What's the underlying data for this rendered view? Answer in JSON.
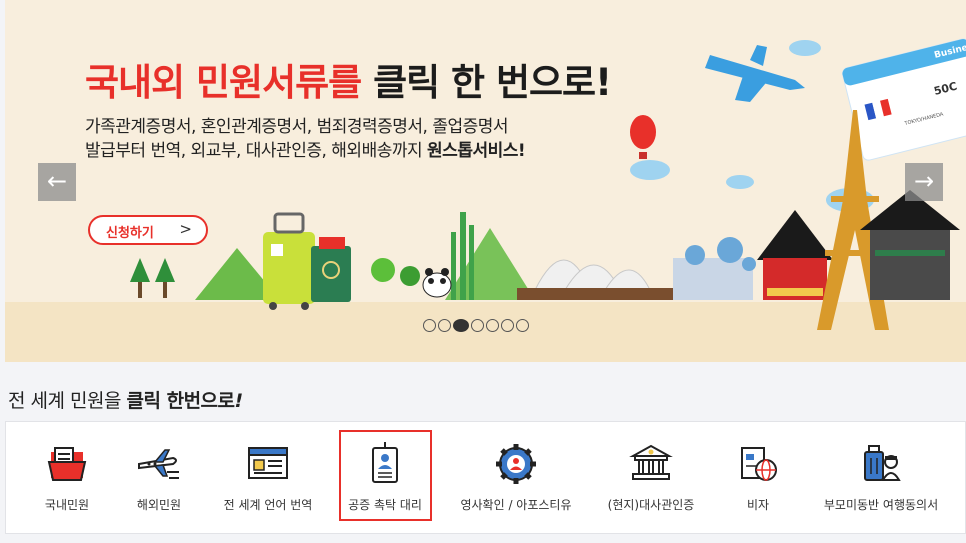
{
  "banner": {
    "headline_red": "국내외 민원서류를",
    "headline_dark": "클릭 한 번으로!",
    "line1": "가족관계증명서, 혼인관계증명서, 범죄경력증명서, 졸업증명서",
    "line2_prefix": "발급부터 번역, 외교부, 대사관인증, 해외배송까지",
    "line2_bold": "원스톱서비스!",
    "apply_label": "신청하기",
    "apply_arrow": ">",
    "prev_arrow": "←",
    "next_arrow": "→",
    "ticket_brand": "Business",
    "ticket_seat": "50C",
    "ticket_dest": "TOKYO/HANEDA",
    "slide_count": 7,
    "active_slide": 3
  },
  "section": {
    "title_prefix": "전 세계 민원을",
    "title_bold": "클릭 한번으로",
    "title_mark": "!"
  },
  "menu": {
    "items": [
      {
        "label": "국내민원",
        "icon": "folder-document-icon"
      },
      {
        "label": "해외민원",
        "icon": "airplane-icon"
      },
      {
        "label": "전 세계 언어 번역",
        "icon": "translation-document-icon"
      },
      {
        "label": "공증 촉탁 대리",
        "icon": "id-badge-icon"
      },
      {
        "label": "영사확인 / 아포스티유",
        "icon": "gear-person-icon"
      },
      {
        "label": "(현지)대사관인증",
        "icon": "embassy-building-icon"
      },
      {
        "label": "비자",
        "icon": "visa-globe-icon"
      },
      {
        "label": "부모미동반 여행동의서",
        "icon": "luggage-icon"
      }
    ]
  },
  "colors": {
    "accent_red": "#e8302a",
    "icon_red": "#e8302a",
    "icon_blue": "#3a78c8",
    "icon_dark": "#222222"
  }
}
